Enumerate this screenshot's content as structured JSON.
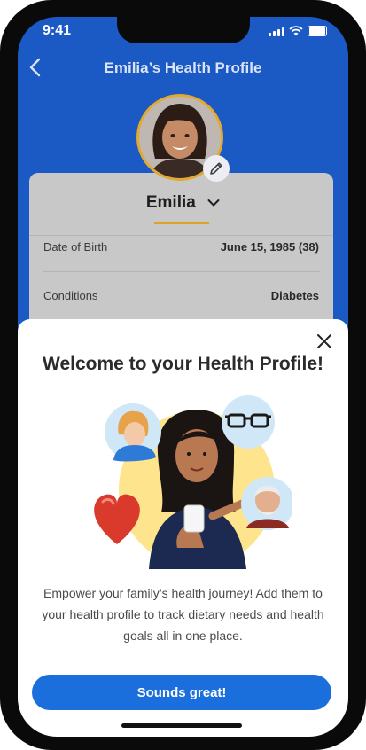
{
  "status_bar": {
    "time": "9:41"
  },
  "header": {
    "title": "Emilia’s Health Profile",
    "back_icon": "chevron-left-icon"
  },
  "profile": {
    "name": "Emilia",
    "rows": [
      {
        "label": "Date of Birth",
        "value": "June 15, 1985 (38)"
      },
      {
        "label": "Conditions",
        "value": "Diabetes"
      }
    ]
  },
  "modal": {
    "title": "Welcome to your Health Profile!",
    "body": "Empower your family’s health journey! Add them to your health profile to track dietary needs and health goals all in one place.",
    "button_label": "Sounds great!",
    "close_icon": "close-icon"
  },
  "colors": {
    "header_blue": "#1b59c4",
    "accent_gold": "#e2a92e",
    "button_blue": "#1b6fdd",
    "heart_red": "#d93a2b"
  }
}
